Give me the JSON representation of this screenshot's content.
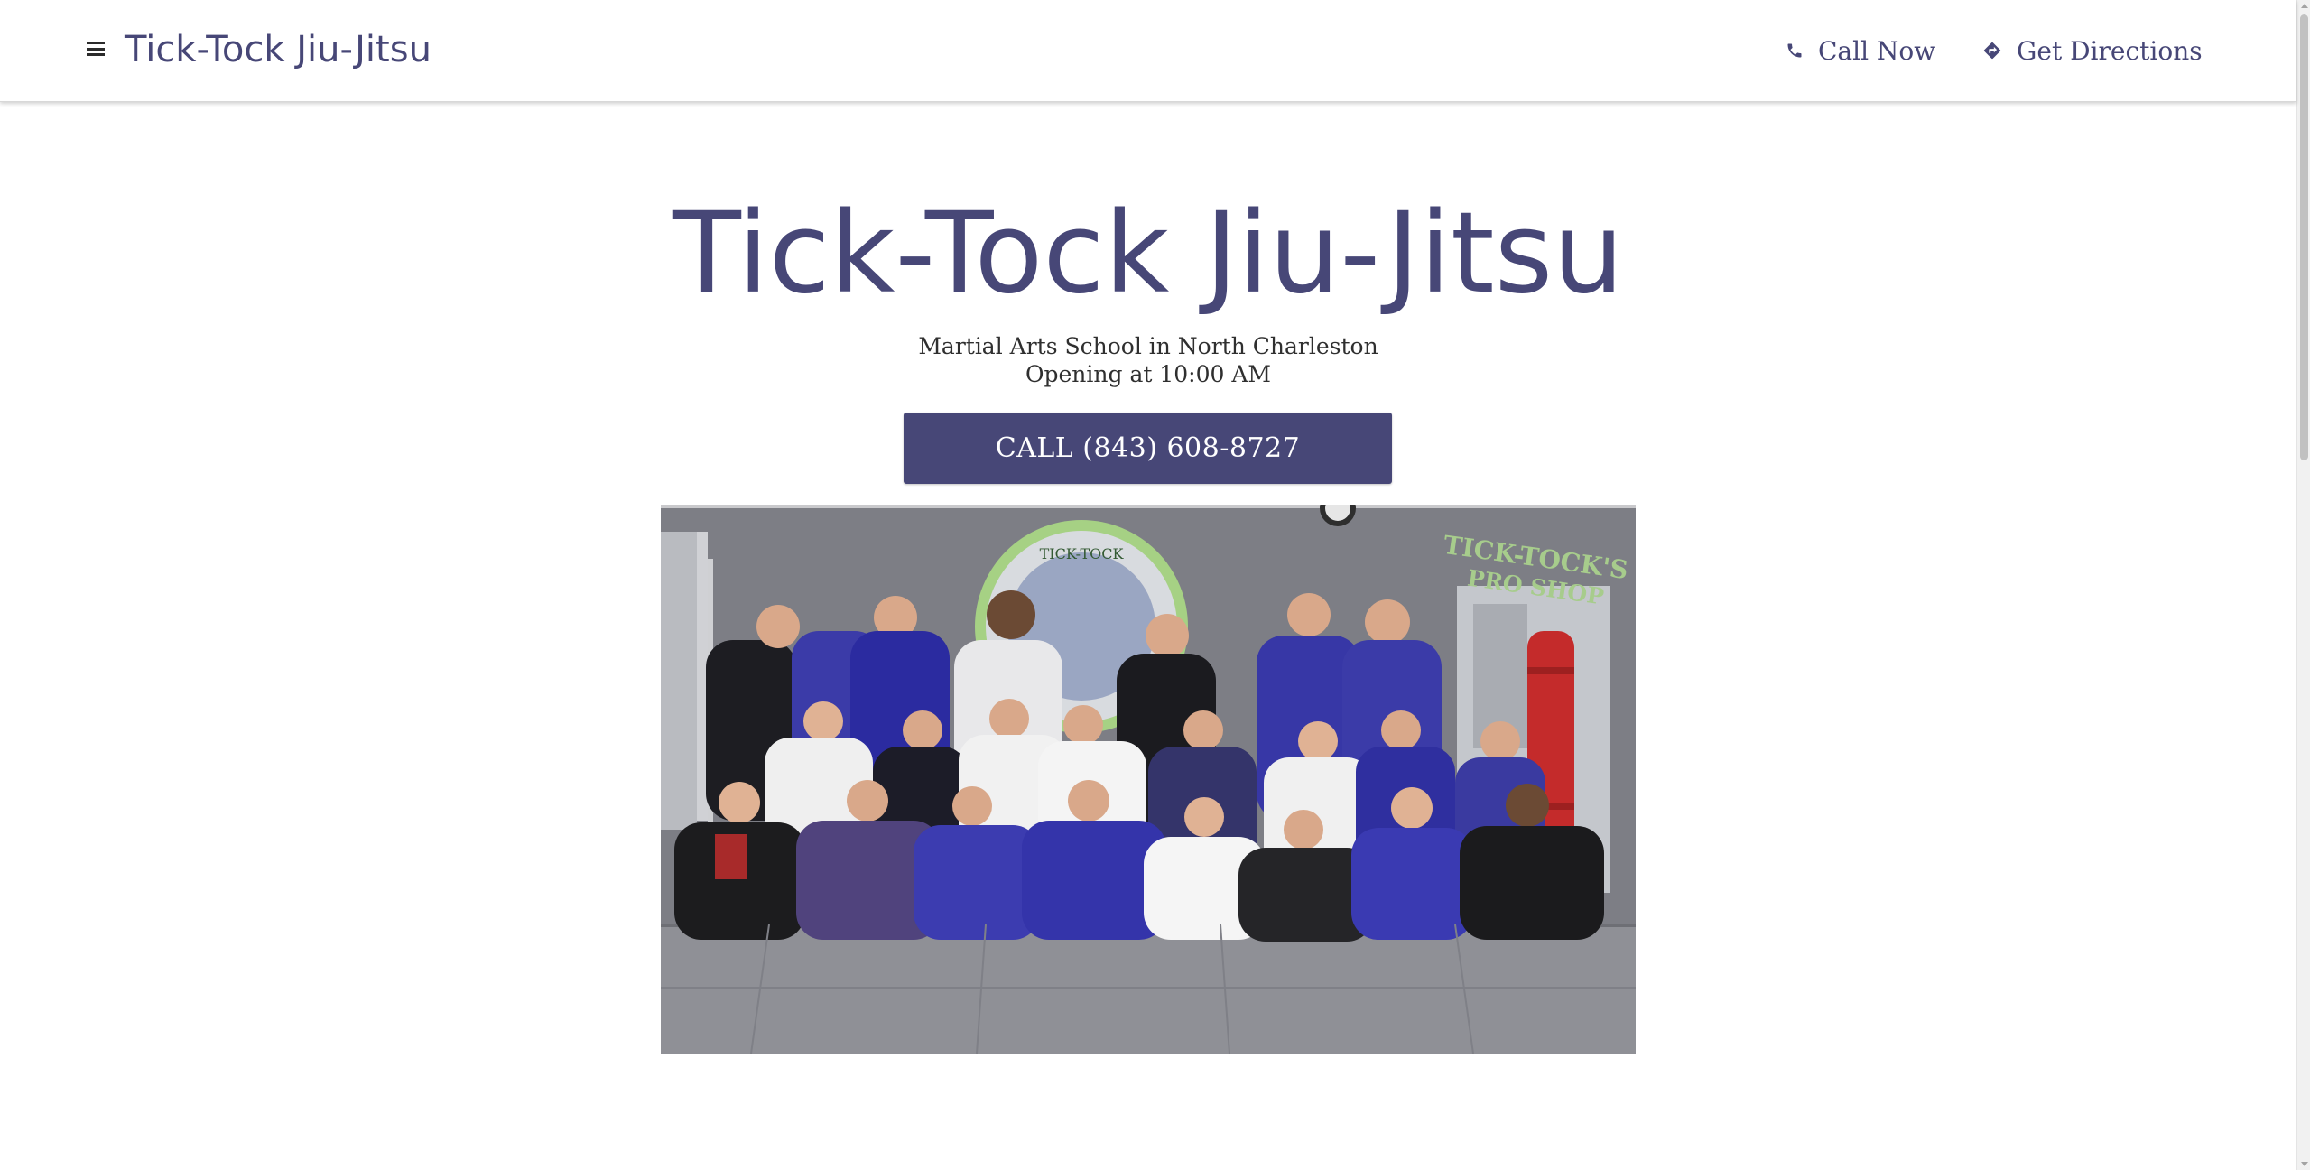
{
  "header": {
    "brand": "Tick-Tock Jiu-Jitsu",
    "menu_icon": "hamburger-menu-icon",
    "call_now_label": "Call Now",
    "call_now_icon": "phone-icon",
    "directions_label": "Get Directions",
    "directions_icon": "directions-icon"
  },
  "hero": {
    "title": "Tick-Tock Jiu-Jitsu",
    "category": "Martial Arts School in North Charleston",
    "hours": "Opening at 10:00 AM",
    "cta_label": "CALL (843) 608-8727"
  },
  "photo": {
    "wall_logo_text": "TICK-TOCK",
    "shop_sign_line1": "TICK-TOCK'S",
    "shop_sign_line2": "PRO SHOP"
  },
  "colors": {
    "accent": "#474777",
    "header_bg": "#ffffff",
    "body_text": "#2f2f2f"
  }
}
